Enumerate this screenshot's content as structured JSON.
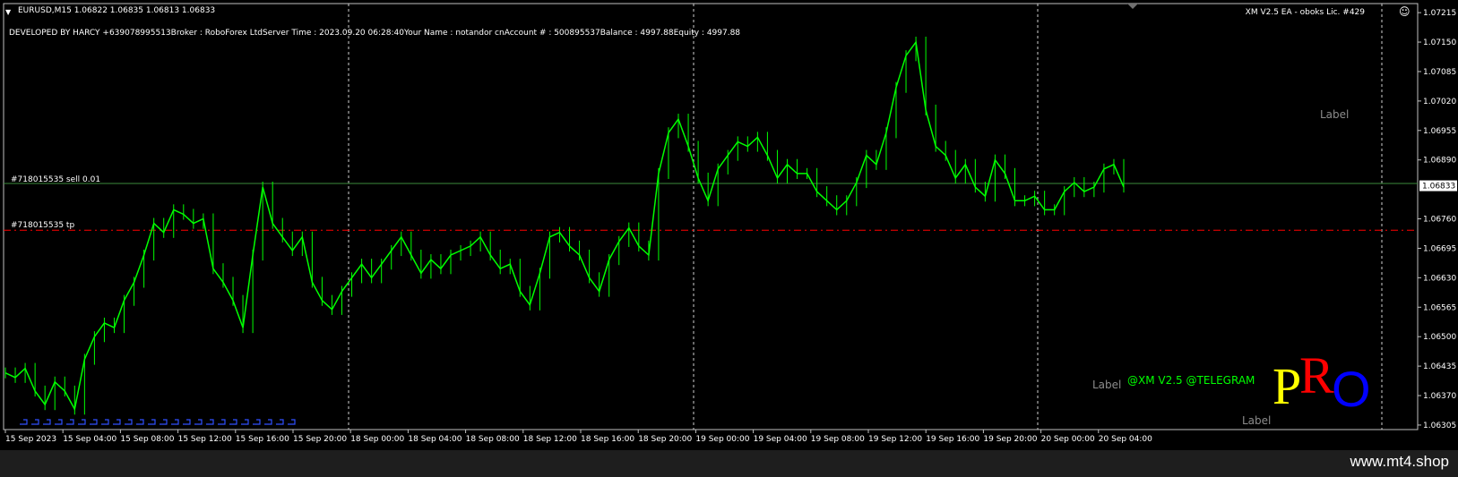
{
  "header": {
    "symbol_line": "EURUSD,M15  1.06822 1.06835 1.06813 1.06833",
    "ea_info": "XM V2.5 EA - oboks Lic. #429",
    "info_line": "DEVELOPED BY HARCY +639078995513Broker  : RoboForex LtdServer Time : 2023.09.20 06:28:40Your Name    : notandor cnAccount #  : 500895537Balance : 4997.88Equity    : 4997.88"
  },
  "orders": {
    "sell_label": "#718015535 sell 0.01",
    "tp_label": "#718015535 tp"
  },
  "overlay": {
    "telegram": "@XM V2.5 @TELEGRAM",
    "label_top": "Label",
    "label_mid": "Label",
    "label_bottom": "Label",
    "logo_p": "P",
    "logo_r": "R",
    "logo_o": "O"
  },
  "footer": {
    "watermark": "www.mt4.shop"
  },
  "colors": {
    "background": "#000000",
    "candles": "#00ff00",
    "sell_line": "#3c8c3c",
    "tp_line": "#ff0000",
    "price_tag_bg": "#ffffff",
    "label_grey": "#8c8c8c",
    "telegram_green": "#00ff00",
    "logo_p": "#ffff00",
    "logo_r": "#ff0000",
    "logo_o": "#0000ff"
  },
  "chart_data": {
    "type": "line",
    "symbol": "EURUSD",
    "timeframe": "M15",
    "y_ticks": [
      "1.07215",
      "1.07150",
      "1.07085",
      "1.07020",
      "1.06955",
      "1.06890",
      "1.06760",
      "1.06695",
      "1.06630",
      "1.06565",
      "1.06500",
      "1.06435",
      "1.06370",
      "1.06305"
    ],
    "current_price": "1.06833",
    "ylim": [
      1.06295,
      1.07235
    ],
    "x_ticks": [
      "15 Sep 2023",
      "15 Sep 04:00",
      "15 Sep 08:00",
      "15 Sep 12:00",
      "15 Sep 16:00",
      "15 Sep 20:00",
      "18 Sep 00:00",
      "18 Sep 04:00",
      "18 Sep 08:00",
      "18 Sep 12:00",
      "18 Sep 16:00",
      "18 Sep 20:00",
      "19 Sep 00:00",
      "19 Sep 04:00",
      "19 Sep 08:00",
      "19 Sep 12:00",
      "19 Sep 16:00",
      "19 Sep 20:00",
      "20 Sep 00:00",
      "20 Sep 04:00"
    ],
    "sell_price": 1.06838,
    "tp_price": 1.06735,
    "series": [
      {
        "values": [
          1.0642,
          1.0641,
          1.0643,
          1.0638,
          1.0635,
          1.064,
          1.0638,
          1.0634,
          1.0645,
          1.065,
          1.0653,
          1.0652,
          1.0658,
          1.0662,
          1.0668,
          1.0675,
          1.0673,
          1.0678,
          1.0677,
          1.0675,
          1.0676,
          1.0665,
          1.0662,
          1.0658,
          1.0652,
          1.0668,
          1.0683,
          1.0675,
          1.0672,
          1.0669,
          1.0672,
          1.0662,
          1.0658,
          1.0656,
          1.066,
          1.0663,
          1.0666,
          1.0663,
          1.0666,
          1.0669,
          1.0672,
          1.0668,
          1.0664,
          1.0667,
          1.0665,
          1.0668,
          1.0669,
          1.067,
          1.0672,
          1.0668,
          1.0665,
          1.0666,
          1.066,
          1.0657,
          1.0664,
          1.0672,
          1.0673,
          1.067,
          1.0668,
          1.0663,
          1.066,
          1.0667,
          1.0671,
          1.0674,
          1.067,
          1.0668,
          1.0686,
          1.0695,
          1.0698,
          1.0692,
          1.0685,
          1.068,
          1.0687,
          1.069,
          1.0693,
          1.0692,
          1.0694,
          1.069,
          1.0685,
          1.0688,
          1.0686,
          1.0686,
          1.0682,
          1.068,
          1.0678,
          1.068,
          1.0684,
          1.069,
          1.0688,
          1.0695,
          1.0705,
          1.0712,
          1.0715,
          1.07,
          1.0692,
          1.069,
          1.0685,
          1.0688,
          1.0683,
          1.0681,
          1.0689,
          1.0686,
          1.068,
          1.068,
          1.0681,
          1.0678,
          1.0678,
          1.0682,
          1.0684,
          1.0682,
          1.0683,
          1.0687,
          1.0688,
          1.0683
        ]
      }
    ]
  }
}
